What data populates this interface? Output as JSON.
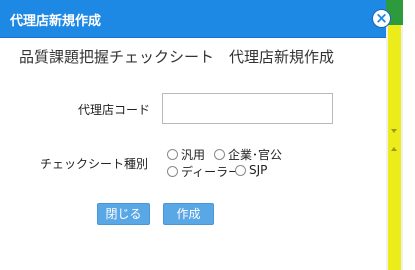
{
  "dialog": {
    "title": "代理店新規作成",
    "close_icon": "×",
    "heading": "品質課題把握チェックシート　代理店新規作成"
  },
  "form": {
    "code_label": "代理店コード",
    "code_value": "",
    "type_label": "チェックシート種別",
    "type_options": [
      "汎用",
      "企業･官公",
      "ディーラー",
      "SJP"
    ]
  },
  "buttons": {
    "close_label": "閉じる",
    "create_label": "作成"
  },
  "colors": {
    "titlebar": "#1e88e5",
    "button": "#5aa7e6",
    "scroll_thumb": "#ecec1a",
    "scroll_corner": "#2e9a3e"
  }
}
